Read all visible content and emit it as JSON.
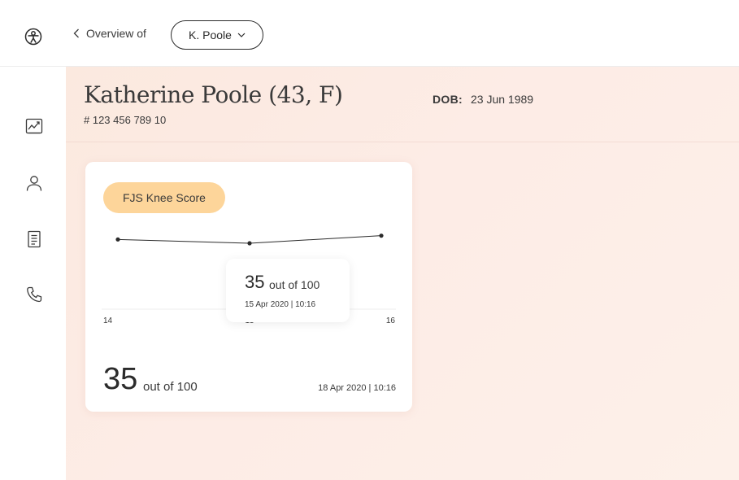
{
  "topbar": {
    "back_label": "Overview of",
    "patient_selector": "K. Poole"
  },
  "sidebar": {
    "items": [
      {
        "icon": "trend-chart-icon"
      },
      {
        "icon": "person-icon"
      },
      {
        "icon": "document-list-icon"
      },
      {
        "icon": "phone-icon"
      }
    ]
  },
  "patient": {
    "name": "Katherine Poole (43, F)",
    "id": "# 123 456 789 10",
    "dob_label": "DOB:",
    "dob_value": "23 Jun 1989"
  },
  "score_card": {
    "badge": "FJS Knee Score",
    "tooltip": {
      "value": "35",
      "out_of": "out of 100",
      "date": "15 Apr 2020 | 10:16"
    },
    "latest": {
      "value": "35",
      "out_of": "out of 100",
      "date": "18 Apr 2020 | 10:16"
    }
  },
  "chart_data": {
    "type": "line",
    "x": [
      14,
      15,
      16
    ],
    "tick_labels": [
      "14",
      "15",
      "16"
    ],
    "series": [
      {
        "values": [
          36,
          35,
          37
        ]
      }
    ],
    "title": "FJS Knee Score",
    "xlabel": "",
    "ylabel": "",
    "ylim": [
      0,
      100
    ],
    "grid": false,
    "colors": {
      "line": "#2b2b2b",
      "axis": "#eeeeee"
    }
  },
  "colors": {
    "badge": "#fdd59a",
    "background_gradient": "#fbe9df"
  }
}
